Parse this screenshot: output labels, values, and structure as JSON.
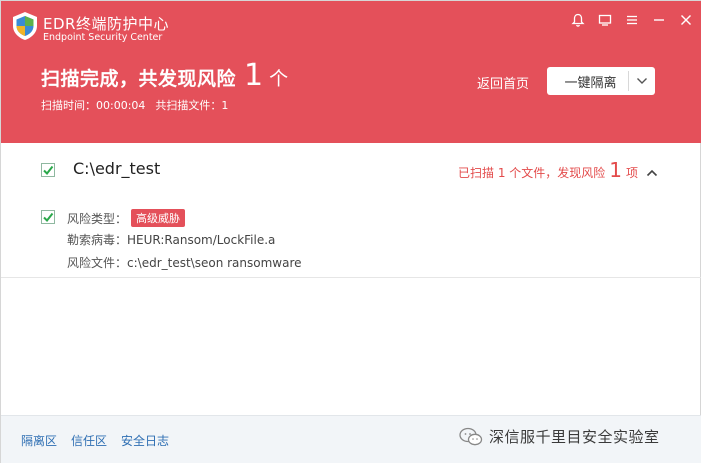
{
  "app": {
    "title": "EDR终端防护中心",
    "subtitle": "Endpoint Security Center"
  },
  "colors": {
    "header_bg": "#e4505a",
    "risk_red": "#e34b4b",
    "link_blue": "#2f6fb3",
    "check_green": "#2aa84a"
  },
  "window_controls": {
    "icons": [
      "bell-icon",
      "monitor-icon",
      "menu-icon",
      "minimize-icon",
      "close-icon"
    ]
  },
  "scan": {
    "headline_prefix": "扫描完成，共发现风险",
    "risk_count": "1",
    "headline_unit": "个",
    "time_label": "扫描时间：00:00:04",
    "files_label": "共扫描文件：1"
  },
  "actions": {
    "back_label": "返回首页",
    "isolate_label": "一键隔离"
  },
  "result_group": {
    "path": "C:\\edr_test",
    "summary_prefix": "已扫描 1 个文件，发现风险",
    "summary_count": "1",
    "summary_unit": "项",
    "checked": true
  },
  "threat": {
    "checked": true,
    "type_label": "风险类型：",
    "type_badge": "高级威胁",
    "virus_label": "勒索病毒：",
    "virus_value": "HEUR:Ransom/LockFile.a",
    "file_label": "风险文件：",
    "file_value": "c:\\edr_test\\seon ransomware"
  },
  "footer": {
    "links": [
      "隔离区",
      "信任区",
      "安全日志"
    ],
    "watermark": "深信服千里目安全实验室"
  }
}
